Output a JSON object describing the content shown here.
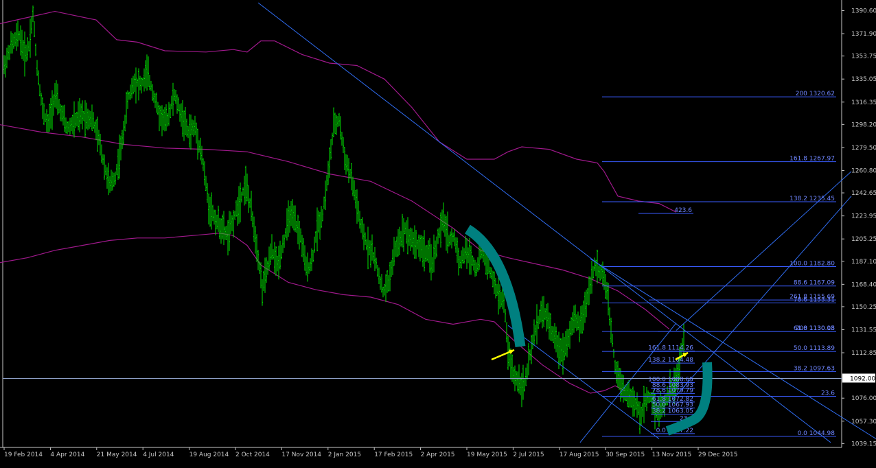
{
  "chart_data": {
    "type": "bar",
    "title": "",
    "colors": {
      "background": "#000000",
      "bars": "#00e400",
      "envelope": "#a0198c",
      "trendline": "#2f6cf0",
      "fib": "#3a5cff",
      "fib_text": "#6f86ff",
      "price_line": "#8ea0c8",
      "axis_text": "#c8c8c8",
      "marker": "#008080",
      "arrow": "#ffff00"
    },
    "y_axis": {
      "min": 1036.0,
      "max": 1397.0,
      "ticks": [
        "1390.60",
        "1371.90",
        "1353.75",
        "1335.05",
        "1316.35",
        "1298.20",
        "1279.50",
        "1260.80",
        "1242.65",
        "1223.95",
        "1205.25",
        "1187.10",
        "1168.40",
        "1150.25",
        "1131.55",
        "1112.85",
        "1076.00",
        "1057.30",
        "1039.15"
      ],
      "current_price": "1092.00"
    },
    "x_axis": {
      "labels": [
        "19 Feb 2014",
        "4 Apr 2014",
        "21 May 2014",
        "4 Jul 2014",
        "19 Aug 2014",
        "2 Oct 2014",
        "17 Nov 2014",
        "2 Jan 2015",
        "17 Feb 2015",
        "2 Apr 2015",
        "19 May 2015",
        "2 Jul 2015",
        "17 Aug 2015",
        "30 Sep 2015",
        "13 Nov 2015",
        "29 Dec 2015"
      ]
    },
    "series": [
      {
        "values": [
          [
            0,
            1345
          ],
          [
            10,
            1362
          ],
          [
            22,
            1371
          ],
          [
            30,
            1355
          ],
          [
            36,
            1362
          ],
          [
            42,
            1388
          ],
          [
            48,
            1345
          ],
          [
            56,
            1310
          ],
          [
            64,
            1298
          ],
          [
            74,
            1322
          ],
          [
            84,
            1306
          ],
          [
            92,
            1295
          ],
          [
            102,
            1300
          ],
          [
            114,
            1306
          ],
          [
            128,
            1303
          ],
          [
            138,
            1286
          ],
          [
            146,
            1265
          ],
          [
            154,
            1248
          ],
          [
            162,
            1256
          ],
          [
            172,
            1284
          ],
          [
            180,
            1318
          ],
          [
            190,
            1334
          ],
          [
            200,
            1330
          ],
          [
            208,
            1340
          ],
          [
            216,
            1326
          ],
          [
            226,
            1306
          ],
          [
            236,
            1300
          ],
          [
            248,
            1322
          ],
          [
            258,
            1306
          ],
          [
            268,
            1292
          ],
          [
            278,
            1296
          ],
          [
            288,
            1273
          ],
          [
            298,
            1233
          ],
          [
            308,
            1221
          ],
          [
            318,
            1213
          ],
          [
            326,
            1208
          ],
          [
            334,
            1221
          ],
          [
            344,
            1238
          ],
          [
            352,
            1250
          ],
          [
            360,
            1228
          ],
          [
            368,
            1200
          ],
          [
            376,
            1165
          ],
          [
            382,
            1178
          ],
          [
            390,
            1196
          ],
          [
            398,
            1184
          ],
          [
            408,
            1205
          ],
          [
            416,
            1225
          ],
          [
            424,
            1218
          ],
          [
            432,
            1207
          ],
          [
            440,
            1181
          ],
          [
            448,
            1186
          ],
          [
            456,
            1214
          ],
          [
            464,
            1226
          ],
          [
            472,
            1258
          ],
          [
            480,
            1296
          ],
          [
            488,
            1302
          ],
          [
            496,
            1272
          ],
          [
            504,
            1258
          ],
          [
            512,
            1238
          ],
          [
            520,
            1214
          ],
          [
            528,
            1201
          ],
          [
            536,
            1195
          ],
          [
            544,
            1180
          ],
          [
            552,
            1162
          ],
          [
            560,
            1170
          ],
          [
            568,
            1193
          ],
          [
            576,
            1205
          ],
          [
            584,
            1214
          ],
          [
            592,
            1205
          ],
          [
            600,
            1202
          ],
          [
            608,
            1198
          ],
          [
            616,
            1193
          ],
          [
            624,
            1186
          ],
          [
            632,
            1206
          ],
          [
            640,
            1221
          ],
          [
            648,
            1205
          ],
          [
            656,
            1206
          ],
          [
            664,
            1186
          ],
          [
            672,
            1195
          ],
          [
            680,
            1190
          ],
          [
            688,
            1181
          ],
          [
            696,
            1196
          ],
          [
            704,
            1185
          ],
          [
            712,
            1172
          ],
          [
            720,
            1160
          ],
          [
            728,
            1155
          ],
          [
            734,
            1115
          ],
          [
            742,
            1094
          ],
          [
            750,
            1090
          ],
          [
            758,
            1086
          ],
          [
            766,
            1110
          ],
          [
            774,
            1132
          ],
          [
            782,
            1146
          ],
          [
            790,
            1143
          ],
          [
            798,
            1130
          ],
          [
            806,
            1118
          ],
          [
            814,
            1114
          ],
          [
            822,
            1126
          ],
          [
            830,
            1140
          ],
          [
            838,
            1135
          ],
          [
            846,
            1148
          ],
          [
            854,
            1170
          ],
          [
            860,
            1183
          ],
          [
            866,
            1180
          ],
          [
            872,
            1176
          ],
          [
            878,
            1162
          ],
          [
            884,
            1132
          ],
          [
            890,
            1103
          ],
          [
            896,
            1092
          ],
          [
            904,
            1082
          ],
          [
            912,
            1077
          ],
          [
            920,
            1070
          ],
          [
            928,
            1062
          ],
          [
            934,
            1074
          ],
          [
            940,
            1078
          ],
          [
            946,
            1072
          ],
          [
            952,
            1064
          ],
          [
            958,
            1070
          ],
          [
            964,
            1074
          ],
          [
            970,
            1082
          ],
          [
            976,
            1086
          ],
          [
            982,
            1097
          ],
          [
            986,
            1112
          ],
          [
            990,
            1126
          ]
        ]
      }
    ],
    "envelope_upper": [
      [
        0,
        1380
      ],
      [
        40,
        1385
      ],
      [
        80,
        1390
      ],
      [
        140,
        1383
      ],
      [
        170,
        1367
      ],
      [
        200,
        1365
      ],
      [
        240,
        1358
      ],
      [
        300,
        1357
      ],
      [
        340,
        1359
      ],
      [
        360,
        1357
      ],
      [
        380,
        1366
      ],
      [
        400,
        1366
      ],
      [
        440,
        1355
      ],
      [
        480,
        1348
      ],
      [
        520,
        1346
      ],
      [
        560,
        1335
      ],
      [
        600,
        1312
      ],
      [
        640,
        1284
      ],
      [
        680,
        1270
      ],
      [
        720,
        1270
      ],
      [
        740,
        1276
      ],
      [
        760,
        1280
      ],
      [
        800,
        1278
      ],
      [
        840,
        1270
      ],
      [
        870,
        1267
      ],
      [
        880,
        1260
      ],
      [
        900,
        1240
      ],
      [
        930,
        1236
      ],
      [
        960,
        1234
      ],
      [
        985,
        1227
      ]
    ],
    "envelope_middle": [
      [
        0,
        1298
      ],
      [
        60,
        1292
      ],
      [
        120,
        1288
      ],
      [
        180,
        1282
      ],
      [
        240,
        1279
      ],
      [
        300,
        1278
      ],
      [
        360,
        1276
      ],
      [
        420,
        1268
      ],
      [
        480,
        1258
      ],
      [
        540,
        1252
      ],
      [
        600,
        1236
      ],
      [
        660,
        1214
      ],
      [
        700,
        1196
      ],
      [
        740,
        1190
      ],
      [
        780,
        1185
      ],
      [
        820,
        1180
      ],
      [
        860,
        1173
      ],
      [
        900,
        1163
      ],
      [
        940,
        1148
      ],
      [
        975,
        1132
      ]
    ],
    "envelope_lower": [
      [
        0,
        1186
      ],
      [
        40,
        1190
      ],
      [
        80,
        1196
      ],
      [
        120,
        1200
      ],
      [
        160,
        1204
      ],
      [
        200,
        1206
      ],
      [
        240,
        1206
      ],
      [
        280,
        1208
      ],
      [
        320,
        1210
      ],
      [
        340,
        1208
      ],
      [
        360,
        1200
      ],
      [
        380,
        1184
      ],
      [
        420,
        1170
      ],
      [
        460,
        1164
      ],
      [
        500,
        1160
      ],
      [
        540,
        1158
      ],
      [
        580,
        1152
      ],
      [
        620,
        1140
      ],
      [
        660,
        1136
      ],
      [
        700,
        1140
      ],
      [
        720,
        1138
      ],
      [
        750,
        1122
      ],
      [
        790,
        1103
      ],
      [
        830,
        1088
      ],
      [
        860,
        1080
      ],
      [
        880,
        1082
      ],
      [
        896,
        1086
      ],
      [
        910,
        1082
      ]
    ],
    "trendlines": [
      [
        [
          376,
          1397
        ],
        [
          1210,
          1040
        ]
      ],
      [
        [
          860,
          1189
        ],
        [
          1276,
          1043
        ]
      ],
      [
        [
          845,
          1040
        ],
        [
          985,
          1137
        ]
      ],
      [
        [
          985,
          1131
        ],
        [
          1240,
          1260
        ]
      ],
      [
        [
          980,
          1075
        ],
        [
          1240,
          1240
        ]
      ],
      [
        [
          740,
          1135
        ],
        [
          960,
          1043
        ]
      ]
    ],
    "fib_levels": [
      {
        "label": "200 1320.62",
        "value": 1320.62,
        "x0": 877,
        "x1": 1218
      },
      {
        "label": "161.8 1267.97",
        "value": 1267.97,
        "x0": 877,
        "x1": 1218
      },
      {
        "label": "138.2 1235.45",
        "value": 1235.45,
        "x0": 877,
        "x1": 1218
      },
      {
        "label": "100.0 1182.80",
        "value": 1182.8,
        "x0": 877,
        "x1": 1218
      },
      {
        "label": "88.6 1167.09",
        "value": 1167.09,
        "x0": 877,
        "x1": 1218
      },
      {
        "label": "78.6 1153.31",
        "value": 1153.31,
        "x0": 877,
        "x1": 1218
      },
      {
        "label": "61.8 1130.15",
        "value": 1130.15,
        "x0": 877,
        "x1": 1218
      },
      {
        "label": "50.0 1113.89",
        "value": 1113.89,
        "x0": 877,
        "x1": 1218
      },
      {
        "label": "38.2 1097.63",
        "value": 1097.63,
        "x0": 877,
        "x1": 1218
      },
      {
        "label": "23.6",
        "value": 1077.5,
        "x0": 877,
        "x1": 1218
      },
      {
        "label": "0.0 1044.98",
        "value": 1044.98,
        "x0": 877,
        "x1": 1218
      },
      {
        "label": "423.6",
        "value": 1226.0,
        "x0": 930,
        "x1": 1010
      },
      {
        "label": "261.8 1155.69",
        "value": 1155.69,
        "x0": 945,
        "x1": 1218
      },
      {
        "label": "200 1130.08",
        "value": 1130.08,
        "x0": 958,
        "x1": 1218
      },
      {
        "label": "161.8 1114.26",
        "value": 1114.26,
        "x0": 948,
        "x1": 1012
      },
      {
        "label": "138.2 1104.48",
        "value": 1104.48,
        "x0": 948,
        "x1": 1012
      },
      {
        "label": "100.0 1088.65",
        "value": 1088.65,
        "x0": 948,
        "x1": 1012
      },
      {
        "label": "88.6 1083.93",
        "value": 1083.93,
        "x0": 948,
        "x1": 1012
      },
      {
        "label": "78.6 1079.79",
        "value": 1079.79,
        "x0": 948,
        "x1": 1012
      },
      {
        "label": "61.8 1072.82",
        "value": 1072.82,
        "x0": 948,
        "x1": 1012
      },
      {
        "label": "50.0 1067.93",
        "value": 1067.93,
        "x0": 948,
        "x1": 1012
      },
      {
        "label": "38.2 1063.05",
        "value": 1063.05,
        "x0": 948,
        "x1": 1012
      },
      {
        "label": "23.6",
        "value": 1057.0,
        "x0": 948,
        "x1": 1012
      },
      {
        "label": "0.0 1047.22",
        "value": 1047.22,
        "x0": 948,
        "x1": 1012
      }
    ]
  }
}
